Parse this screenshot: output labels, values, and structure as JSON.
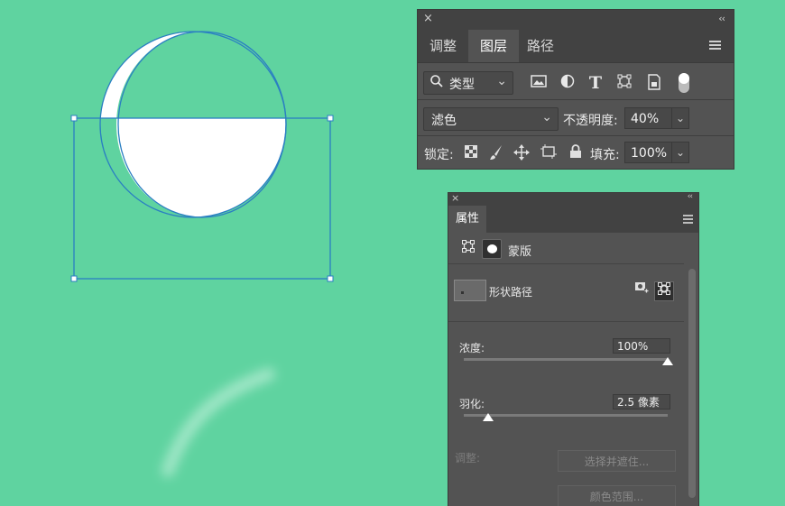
{
  "layers_panel": {
    "close_symbol": "×",
    "collapse_symbol": "‹‹",
    "tabs": [
      {
        "label": "调整",
        "active": false
      },
      {
        "label": "图层",
        "active": true
      },
      {
        "label": "路径",
        "active": false
      }
    ],
    "filter": {
      "search_icon": "magnifier-icon",
      "kind_label": "类型"
    },
    "filter_icons": [
      "image-filter-icon",
      "adjustment-filter-icon",
      "type-filter-icon",
      "shape-filter-icon",
      "smart-object-filter-icon",
      "filter-toggle-icon"
    ],
    "blend_mode": "滤色",
    "opacity_label": "不透明度:",
    "opacity_value": "40%",
    "lock_label": "锁定:",
    "lock_icons": [
      "lock-transparent-icon",
      "lock-image-icon",
      "lock-position-icon",
      "lock-artboard-icon",
      "lock-all-icon"
    ],
    "fill_label": "填充:",
    "fill_value": "100%"
  },
  "properties_panel": {
    "close_symbol": "×",
    "collapse_symbol": "‹‹",
    "tab_label": "属性",
    "mask_label": "蒙版",
    "path_label": "形状路径",
    "density_label": "浓度:",
    "density_value": "100%",
    "density_level": 1.0,
    "feather_label": "羽化:",
    "feather_value": "2.5 像素",
    "feather_level": 0.12,
    "adjust_label": "调整:",
    "select_mask_button": "选择并遮住...",
    "color_range_button": "颜色范围..."
  },
  "colors": {
    "canvas_bg": "#5fd3a0",
    "panel_bg": "#535353",
    "path_stroke": "#2a7fc2"
  }
}
